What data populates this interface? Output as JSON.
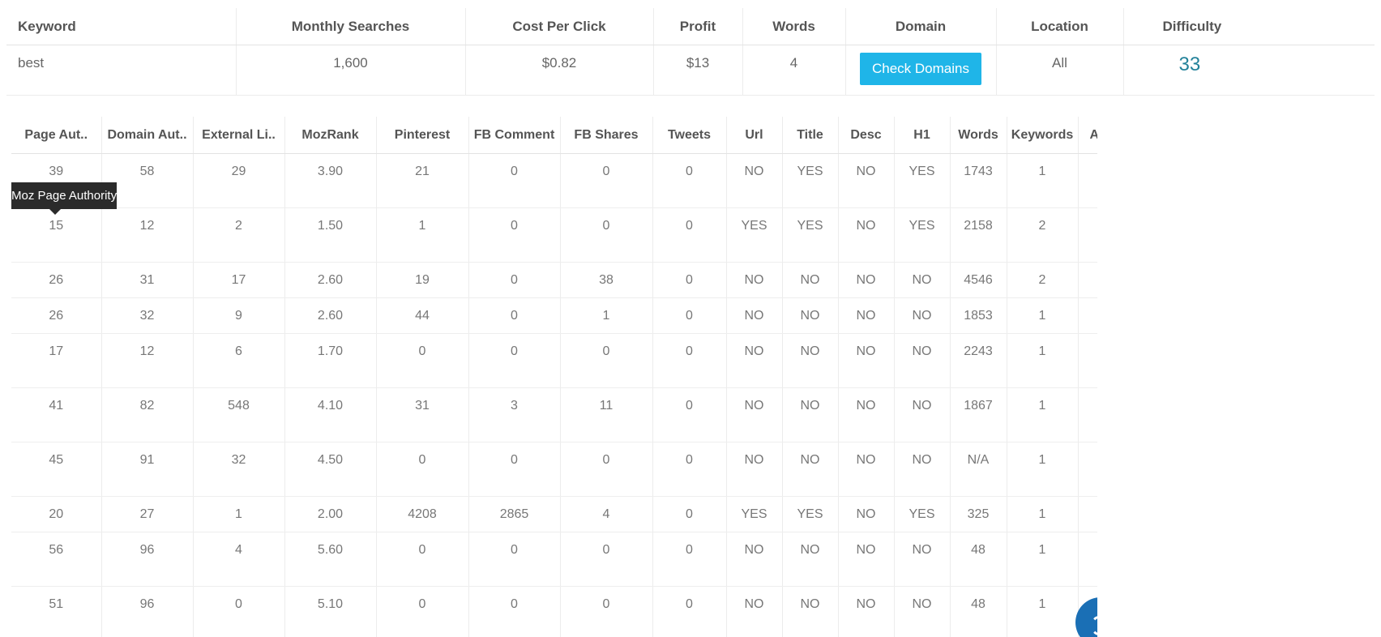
{
  "keyword_table": {
    "headers": [
      "Keyword",
      "Monthly Searches",
      "Cost Per Click",
      "Profit",
      "Words",
      "Domain",
      "Location",
      "Difficulty"
    ],
    "row": {
      "keyword": "best",
      "monthly_searches": "1,600",
      "cost_per_click": "$0.82",
      "profit": "$13",
      "words": "4",
      "domain_button_label": "Check Domains",
      "location": "All",
      "difficulty": "33"
    }
  },
  "results_table": {
    "headers": [
      "Page Aut..",
      "Domain Aut..",
      "External Li..",
      "MozRank",
      "Pinterest",
      "FB Comment",
      "FB Shares",
      "Tweets",
      "Url",
      "Title",
      "Desc",
      "H1",
      "Words",
      "Keywords",
      "AMP"
    ],
    "rows": [
      [
        "39",
        "58",
        "29",
        "3.90",
        "21",
        "0",
        "0",
        "0",
        "NO",
        "YES",
        "NO",
        "YES",
        "1743",
        "1",
        "✖"
      ],
      [
        "15",
        "12",
        "2",
        "1.50",
        "1",
        "0",
        "0",
        "0",
        "YES",
        "YES",
        "NO",
        "YES",
        "2158",
        "2",
        "✖"
      ],
      [
        "26",
        "31",
        "17",
        "2.60",
        "19",
        "0",
        "38",
        "0",
        "NO",
        "NO",
        "NO",
        "NO",
        "4546",
        "2",
        "✖"
      ],
      [
        "26",
        "32",
        "9",
        "2.60",
        "44",
        "0",
        "1",
        "0",
        "NO",
        "NO",
        "NO",
        "NO",
        "1853",
        "1",
        "✖"
      ],
      [
        "17",
        "12",
        "6",
        "1.70",
        "0",
        "0",
        "0",
        "0",
        "NO",
        "NO",
        "NO",
        "NO",
        "2243",
        "1",
        "✖"
      ],
      [
        "41",
        "82",
        "548",
        "4.10",
        "31",
        "3",
        "11",
        "0",
        "NO",
        "NO",
        "NO",
        "NO",
        "1867",
        "1",
        "✖"
      ],
      [
        "45",
        "91",
        "32",
        "4.50",
        "0",
        "0",
        "0",
        "0",
        "NO",
        "NO",
        "NO",
        "NO",
        "N/A",
        "1",
        "✖"
      ],
      [
        "20",
        "27",
        "1",
        "2.00",
        "4208",
        "2865",
        "4",
        "0",
        "YES",
        "YES",
        "NO",
        "YES",
        "325",
        "1",
        "✖"
      ],
      [
        "56",
        "96",
        "4",
        "5.60",
        "0",
        "0",
        "0",
        "0",
        "NO",
        "NO",
        "NO",
        "NO",
        "48",
        "1",
        "✖"
      ],
      [
        "51",
        "96",
        "0",
        "5.10",
        "0",
        "0",
        "0",
        "0",
        "NO",
        "NO",
        "NO",
        "NO",
        "48",
        "1",
        "✖"
      ]
    ]
  },
  "tooltip": {
    "text": "Moz Page Authority"
  },
  "colors": {
    "button": "#1fb5e8",
    "difficulty": "#23829a",
    "tooltip_bg": "#2b2b2b",
    "chat_bubble": "#1a6fb5"
  },
  "icons": {
    "amp_status": "close-x-icon",
    "chat": "chat-bubble-icon"
  }
}
